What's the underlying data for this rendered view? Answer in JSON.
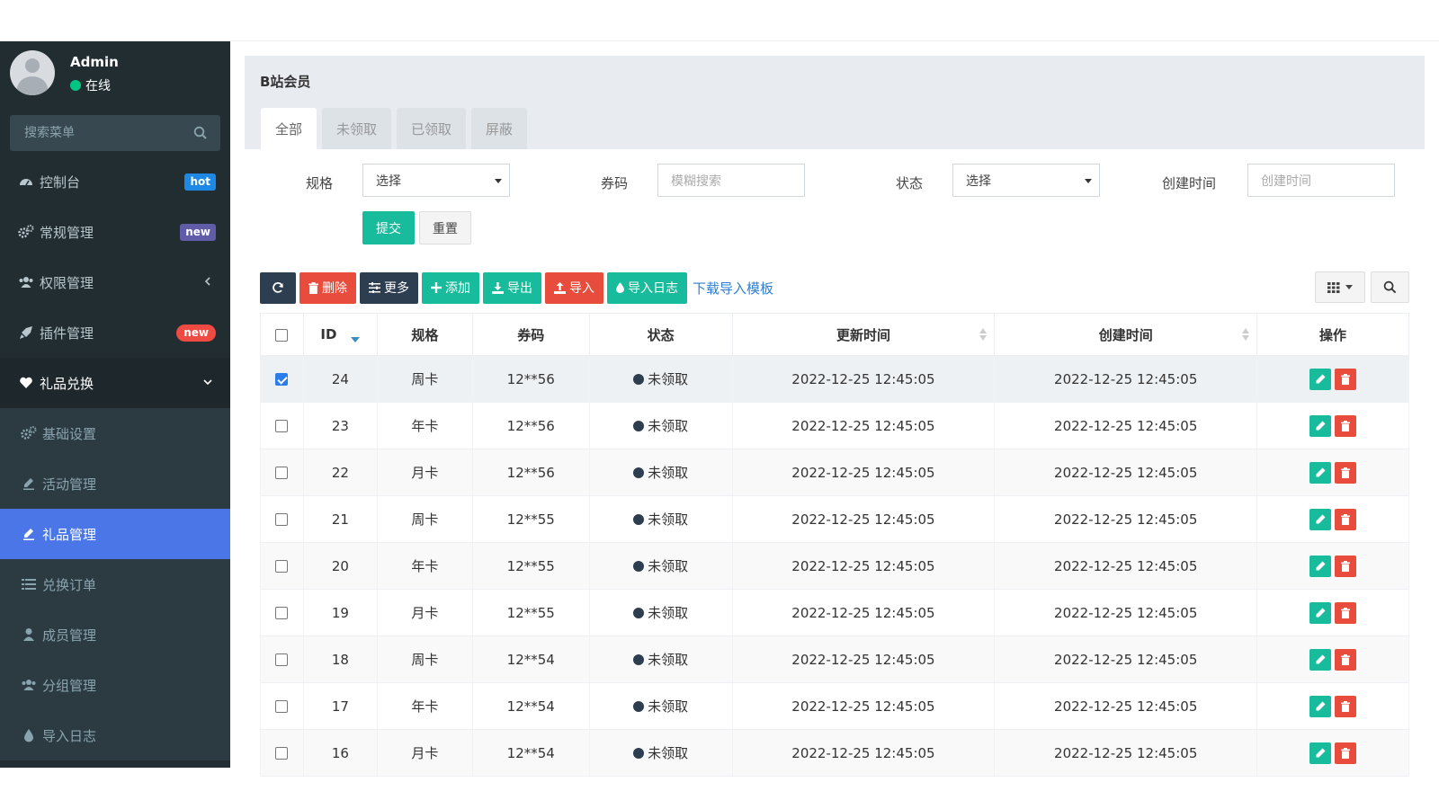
{
  "sidebar": {
    "user": {
      "name": "Admin",
      "status": "在线"
    },
    "search_placeholder": "搜索菜单",
    "items": [
      {
        "label": "控制台",
        "badge": "hot"
      },
      {
        "label": "常规管理",
        "badge": "new"
      },
      {
        "label": "权限管理"
      },
      {
        "label": "插件管理",
        "badge": "new"
      },
      {
        "label": "礼品兑换"
      }
    ],
    "sub_items": [
      {
        "label": "基础设置"
      },
      {
        "label": "活动管理"
      },
      {
        "label": "礼品管理"
      },
      {
        "label": "兑换订单"
      },
      {
        "label": "成员管理"
      },
      {
        "label": "分组管理"
      },
      {
        "label": "导入日志"
      }
    ]
  },
  "panel": {
    "title": "B站会员",
    "tabs": [
      "全部",
      "未领取",
      "已领取",
      "屏蔽"
    ]
  },
  "filters": {
    "spec_label": "规格",
    "spec_value": "选择",
    "code_label": "券码",
    "code_placeholder": "模糊搜索",
    "status_label": "状态",
    "status_value": "选择",
    "created_label": "创建时间",
    "created_placeholder": "创建时间",
    "submit": "提交",
    "reset": "重置"
  },
  "toolbar": {
    "delete": "删除",
    "more": "更多",
    "add": "添加",
    "export": "导出",
    "import": "导入",
    "import_log": "导入日志",
    "download_template": "下载导入模板"
  },
  "table": {
    "headers": [
      "ID",
      "规格",
      "券码",
      "状态",
      "更新时间",
      "创建时间",
      "操作"
    ],
    "rows": [
      {
        "id": "24",
        "spec": "周卡",
        "code": "12**56",
        "status": "未领取",
        "updated": "2022-12-25 12:45:05",
        "created": "2022-12-25 12:45:05",
        "checked": true
      },
      {
        "id": "23",
        "spec": "年卡",
        "code": "12**56",
        "status": "未领取",
        "updated": "2022-12-25 12:45:05",
        "created": "2022-12-25 12:45:05"
      },
      {
        "id": "22",
        "spec": "月卡",
        "code": "12**56",
        "status": "未领取",
        "updated": "2022-12-25 12:45:05",
        "created": "2022-12-25 12:45:05"
      },
      {
        "id": "21",
        "spec": "周卡",
        "code": "12**55",
        "status": "未领取",
        "updated": "2022-12-25 12:45:05",
        "created": "2022-12-25 12:45:05"
      },
      {
        "id": "20",
        "spec": "年卡",
        "code": "12**55",
        "status": "未领取",
        "updated": "2022-12-25 12:45:05",
        "created": "2022-12-25 12:45:05"
      },
      {
        "id": "19",
        "spec": "月卡",
        "code": "12**55",
        "status": "未领取",
        "updated": "2022-12-25 12:45:05",
        "created": "2022-12-25 12:45:05"
      },
      {
        "id": "18",
        "spec": "周卡",
        "code": "12**54",
        "status": "未领取",
        "updated": "2022-12-25 12:45:05",
        "created": "2022-12-25 12:45:05"
      },
      {
        "id": "17",
        "spec": "年卡",
        "code": "12**54",
        "status": "未领取",
        "updated": "2022-12-25 12:45:05",
        "created": "2022-12-25 12:45:05"
      },
      {
        "id": "16",
        "spec": "月卡",
        "code": "12**54",
        "status": "未领取",
        "updated": "2022-12-25 12:45:05",
        "created": "2022-12-25 12:45:05"
      }
    ]
  },
  "colors": {
    "sidebar_bg": "#222d32",
    "active_item": "#4a76e8",
    "success": "#18bc9c",
    "danger": "#e74c3c",
    "dark": "#2c3e50"
  }
}
